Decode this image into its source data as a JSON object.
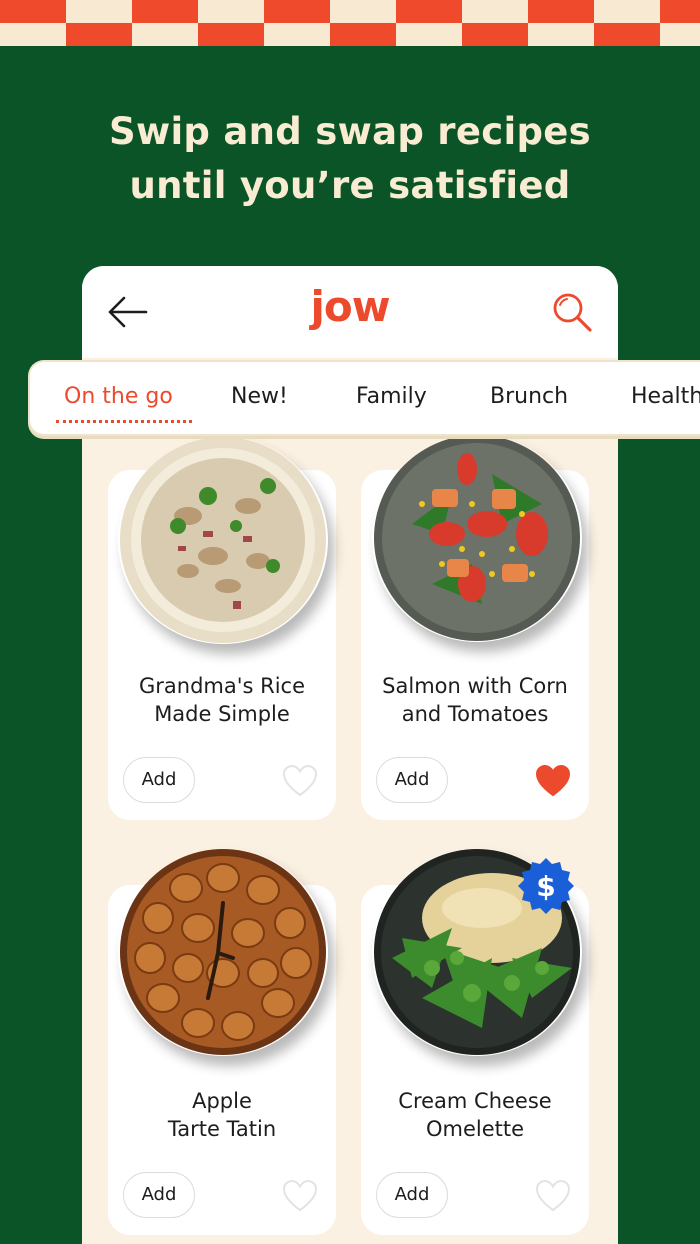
{
  "headline": {
    "line1": "Swip and swap recipes",
    "line2": "until you’re satisfied"
  },
  "header": {
    "logo": "jow",
    "back_icon": "arrow-left-icon",
    "search_icon": "search-icon"
  },
  "tabs": [
    {
      "label": "On the go",
      "active": true
    },
    {
      "label": "New!",
      "active": false
    },
    {
      "label": "Family",
      "active": false
    },
    {
      "label": "Brunch",
      "active": false
    },
    {
      "label": "Health",
      "active": false
    }
  ],
  "recipes": [
    {
      "title_line1": "Grandma's Rice",
      "title_line2": "Made Simple",
      "add_label": "Add",
      "favorited": false
    },
    {
      "title_line1": "Salmon with Corn",
      "title_line2": "and Tomatoes",
      "add_label": "Add",
      "favorited": true
    },
    {
      "title_line1": "Apple",
      "title_line2": "Tarte Tatin",
      "add_label": "Add",
      "favorited": false
    },
    {
      "title_line1": "Cream Cheese",
      "title_line2": "Omelette",
      "add_label": "Add",
      "favorited": false,
      "badge": "$"
    }
  ],
  "colors": {
    "background_green": "#0b5427",
    "accent_red": "#ec4a2c",
    "cream": "#fbf1e3",
    "badge_blue": "#1a5fd8"
  }
}
